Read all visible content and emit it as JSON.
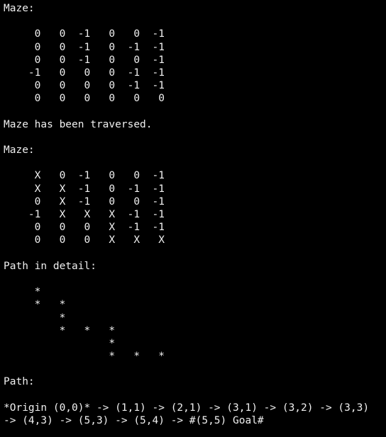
{
  "terminal": {
    "background": "#000000",
    "foreground": "#f0f0f0",
    "lines": [
      "Maze:",
      "",
      "     0   0  -1   0   0  -1",
      "     0   0  -1   0  -1  -1",
      "     0   0  -1   0   0  -1",
      "    -1   0   0   0  -1  -1",
      "     0   0   0   0  -1  -1",
      "     0   0   0   0   0   0",
      "",
      "Maze has been traversed.",
      "",
      "Maze:",
      "",
      "     X   0  -1   0   0  -1",
      "     X   X  -1   0  -1  -1",
      "     0   X  -1   0   0  -1",
      "    -1   X   X   X  -1  -1",
      "     0   0   0   X  -1  -1",
      "     0   0   0   X   X   X",
      "",
      "Path in detail:",
      "",
      "     *",
      "     *   *",
      "         *",
      "         *   *   *",
      "                 *",
      "                 *   *   *",
      "",
      "Path:",
      "",
      "*Origin (0,0)* -> (1,1) -> (2,1) -> (3,1) -> (3,2) -> (3,3)",
      "-> (4,3) -> (5,3) -> (5,4) -> #(5,5) Goal#"
    ]
  }
}
